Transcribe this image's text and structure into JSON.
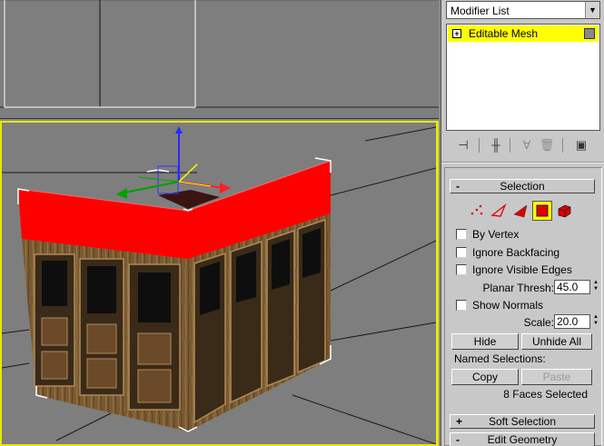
{
  "panel": {
    "modifier_list": "Modifier List",
    "stack_item": "Editable Mesh",
    "stack_item_expander": "+",
    "rollouts": {
      "selection": {
        "label": "Selection",
        "sign": "-"
      },
      "soft_selection": {
        "label": "Soft Selection",
        "sign": "+"
      },
      "edit_geometry": {
        "label": "Edit Geometry",
        "sign": "-"
      }
    },
    "selection": {
      "active_mode": "face",
      "modes": [
        "vertex",
        "edge",
        "face",
        "polygon",
        "element"
      ],
      "by_vertex": {
        "label": "By Vertex",
        "checked": false
      },
      "ignore_backfacing": {
        "label": "Ignore Backfacing",
        "checked": false
      },
      "ignore_visible_edges": {
        "label": "Ignore Visible Edges",
        "checked": false
      },
      "planar_thresh": {
        "label": "Planar Thresh:",
        "value": "45.0"
      },
      "show_normals": {
        "label": "Show Normals",
        "checked": false
      },
      "scale": {
        "label": "Scale:",
        "value": "20.0"
      },
      "hide_button": "Hide",
      "unhide_all_button": "Unhide All",
      "named_selections_label": "Named Selections:",
      "copy_button": "Copy",
      "paste_button": "Paste",
      "status": "8 Faces Selected"
    }
  },
  "icons": [
    "pin-stack-icon",
    "show-end-result-icon",
    "make-unique-icon",
    "remove-modifier-icon",
    "configure-modifier-sets-icon"
  ],
  "colors": {
    "active_viewport_border": "#e8e800",
    "selected_faces": "#ff0000",
    "highlight": "#ffff00",
    "viewport_bg": "#7e7e7e"
  }
}
